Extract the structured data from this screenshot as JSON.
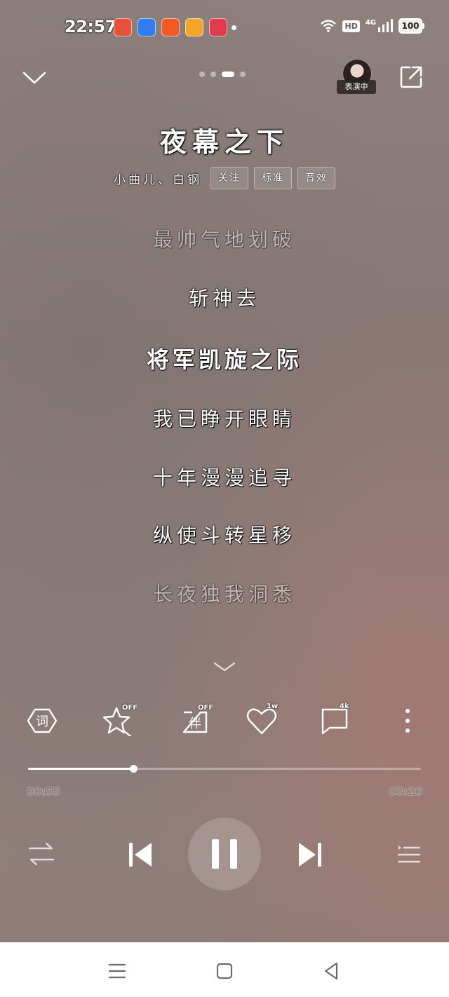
{
  "status_bar": {
    "time": "22:57",
    "network_hd": "HD",
    "network_type": "4G",
    "battery": "100"
  },
  "header": {
    "avatar_tag": "表演中"
  },
  "song": {
    "title": "夜幕之下",
    "artists": "小曲儿、白钢",
    "chips": [
      "关注",
      "标准",
      "音效"
    ]
  },
  "lyrics": [
    {
      "text": "最帅气地划破",
      "state": "dim"
    },
    {
      "text": "斩神去",
      "state": "normal"
    },
    {
      "text": "将军凯旋之际",
      "state": "current"
    },
    {
      "text": "我已睁开眼睛",
      "state": "normal"
    },
    {
      "text": "十年漫漫追寻",
      "state": "normal"
    },
    {
      "text": "纵使斗转星移",
      "state": "normal"
    },
    {
      "text": "长夜独我洞悉",
      "state": "dim"
    }
  ],
  "actions": {
    "lyrics_label": "词",
    "effects_badge": "OFF",
    "accompany_label": "伴",
    "accompany_badge": "OFF",
    "likes_badge": "1w",
    "comments_badge": "4k"
  },
  "playback": {
    "current_time": "00:55",
    "total_time": "03:26",
    "progress": 0.267
  },
  "colors": {
    "accent": "#ffffff",
    "time_text": "#8d807c"
  }
}
